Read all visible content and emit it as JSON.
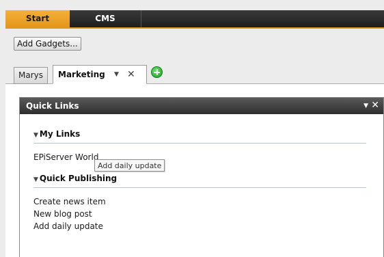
{
  "topbar": {
    "tabs": [
      {
        "label": "Start",
        "active": true
      },
      {
        "label": "CMS",
        "active": false
      }
    ],
    "accent_color": "#e3961a"
  },
  "toolbar": {
    "add_gadgets_label": "Add Gadgets..."
  },
  "dashboard_tabs": {
    "items": [
      {
        "label": "Marys",
        "active": false
      },
      {
        "label": "Marketing",
        "active": true
      }
    ],
    "tab_menu_glyph": "▼",
    "tab_close_glyph": "✕",
    "add_tab_icon": "add-tab-icon"
  },
  "gadget": {
    "title": "Quick Links",
    "menu_glyph": "▼",
    "close_glyph": "✕",
    "sections": [
      {
        "title": "My Links",
        "links": [
          "EPiServer World"
        ]
      },
      {
        "title": "Quick Publishing",
        "links": [
          "Create news item",
          "New blog post",
          "Add daily update"
        ]
      }
    ],
    "collapse_glyph": "▼"
  },
  "tooltip": {
    "text": "Add daily update"
  }
}
